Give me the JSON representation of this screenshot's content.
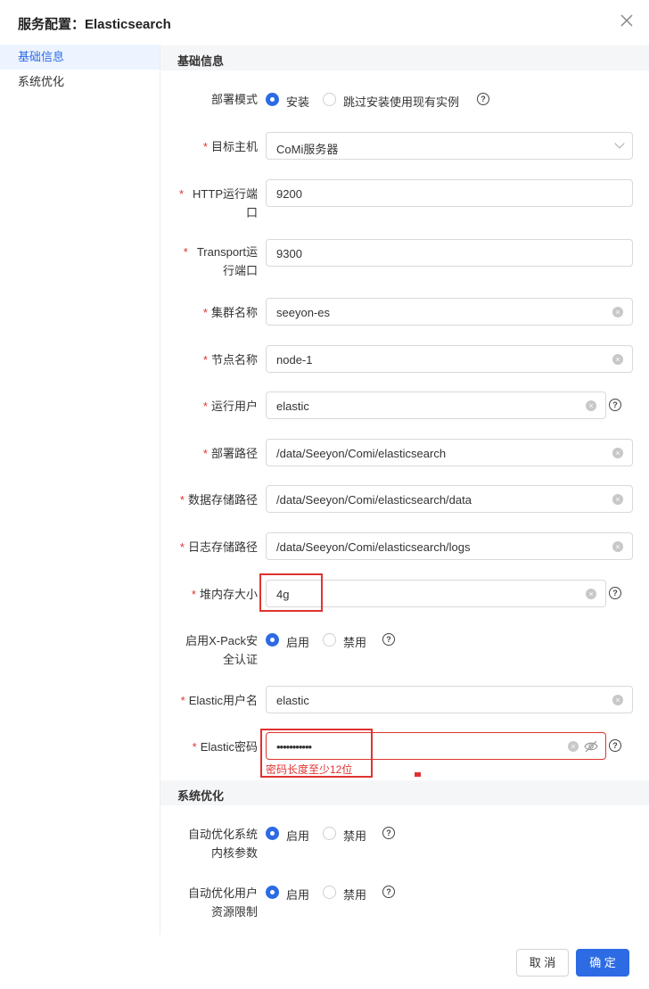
{
  "dialog": {
    "title": "服务配置：Elasticsearch"
  },
  "sidebar": {
    "items": [
      {
        "label": "基础信息"
      },
      {
        "label": "系统优化"
      }
    ]
  },
  "sections": {
    "basic": "基础信息",
    "optimize": "系统优化"
  },
  "fields": {
    "deploy_mode": {
      "label": "部署模式",
      "opt1": "安装",
      "opt2": "跳过安装使用现有实例"
    },
    "target_host": {
      "label": "目标主机",
      "value": "CoMi服务器"
    },
    "http_port": {
      "label1": "HTTP运行端",
      "label2": "口",
      "value": "9200"
    },
    "transport_port": {
      "label1": "Transport运",
      "label2": "行端口",
      "value": "9300"
    },
    "cluster_name": {
      "label": "集群名称",
      "value": "seeyon-es"
    },
    "node_name": {
      "label": "节点名称",
      "value": "node-1"
    },
    "run_user": {
      "label": "运行用户",
      "value": "elastic"
    },
    "deploy_path": {
      "label": "部署路径",
      "value": "/data/Seeyon/Comi/elasticsearch"
    },
    "data_path": {
      "label": "数据存储路径",
      "value": "/data/Seeyon/Comi/elasticsearch/data"
    },
    "log_path": {
      "label": "日志存储路径",
      "value": "/data/Seeyon/Comi/elasticsearch/logs"
    },
    "heap_size": {
      "label": "堆内存大小",
      "value": "4g"
    },
    "xpack": {
      "label1": "启用X-Pack安",
      "label2": "全认证",
      "opt1": "启用",
      "opt2": "禁用"
    },
    "elastic_user": {
      "label": "Elastic用户名",
      "value": "elastic"
    },
    "elastic_pwd": {
      "label": "Elastic密码",
      "value": "•••••••••••",
      "error": "密码长度至少12位"
    },
    "kernel_opt": {
      "label1": "自动优化系统",
      "label2": "内核参数",
      "opt1": "启用",
      "opt2": "禁用"
    },
    "limit_opt": {
      "label1": "自动优化用户",
      "label2": "资源限制",
      "opt1": "启用",
      "opt2": "禁用"
    }
  },
  "buttons": {
    "cancel": "取 消",
    "ok": "确 定"
  },
  "colors": {
    "accent": "#2d6be4",
    "error": "#e0332f",
    "required": "#e0332f"
  }
}
